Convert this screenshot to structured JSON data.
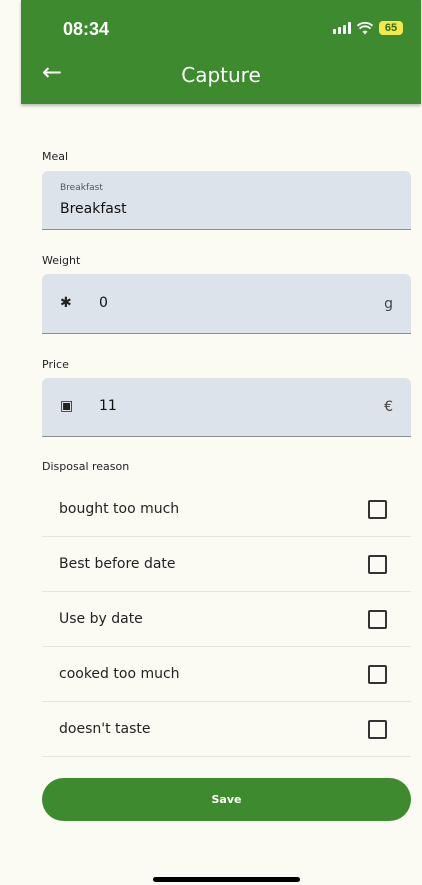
{
  "status": {
    "time": "08:34",
    "battery": "65"
  },
  "appbar": {
    "title": "Capture",
    "back_icon": "←"
  },
  "meal": {
    "label": "Meal",
    "float_label": "Breakfast",
    "value": "Breakfast"
  },
  "weight": {
    "label": "Weight",
    "icon": "✱",
    "value": "0",
    "unit": "g"
  },
  "price": {
    "label": "Price",
    "icon": "▣",
    "value": "11",
    "unit": "€"
  },
  "disposal": {
    "label": "Disposal reason",
    "options": [
      {
        "label": "bought too much",
        "checked": false
      },
      {
        "label": "Best before date",
        "checked": false
      },
      {
        "label": "Use by date",
        "checked": false
      },
      {
        "label": "cooked too much",
        "checked": false
      },
      {
        "label": "doesn't taste",
        "checked": false
      }
    ]
  },
  "save_label": "Save",
  "colors": {
    "primary": "#3e8a2e",
    "field_bg": "#dce3ea",
    "page_bg": "#fbfbf4"
  }
}
